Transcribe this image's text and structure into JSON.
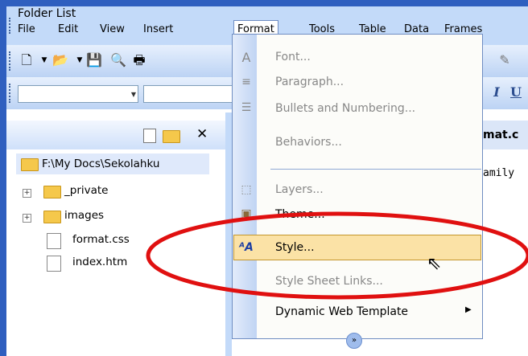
{
  "menubar": {
    "items": [
      "File",
      "Edit",
      "View",
      "Insert",
      "Format",
      "Tools",
      "Table",
      "Data",
      "Frames"
    ],
    "active": "Format"
  },
  "toolbar": {
    "icons": [
      "new-page-icon",
      "open-icon",
      "save-icon",
      "search-icon",
      "print-icon"
    ]
  },
  "folder_list": {
    "title": "Folder List",
    "root": "F:\\My Docs\\Sekolahku",
    "items": [
      {
        "label": "_private",
        "type": "folder"
      },
      {
        "label": "images",
        "type": "folder"
      },
      {
        "label": "format.css",
        "type": "file"
      },
      {
        "label": "index.htm",
        "type": "file"
      }
    ]
  },
  "editor": {
    "line1": "mat.c",
    "line2": "amily"
  },
  "format_menu": {
    "items": [
      {
        "label": "Font...",
        "enabled": false
      },
      {
        "label": "Paragraph...",
        "enabled": false
      },
      {
        "label": "Bullets and Numbering...",
        "enabled": false
      },
      {
        "label": "Behaviors...",
        "enabled": false
      },
      {
        "label": "Layers...",
        "enabled": false
      },
      {
        "label": "Theme...",
        "enabled": true
      },
      {
        "label": "Style...",
        "enabled": true,
        "highlighted": true
      },
      {
        "label": "Style Sheet Links...",
        "enabled": false
      },
      {
        "label": "Dynamic Web Template",
        "enabled": true,
        "submenu": true
      }
    ],
    "expand_glyph": "»"
  },
  "colors": {
    "accent": "#2f5fbf",
    "menu_highlight": "#fbe2a6",
    "annotation": "#e01010"
  }
}
